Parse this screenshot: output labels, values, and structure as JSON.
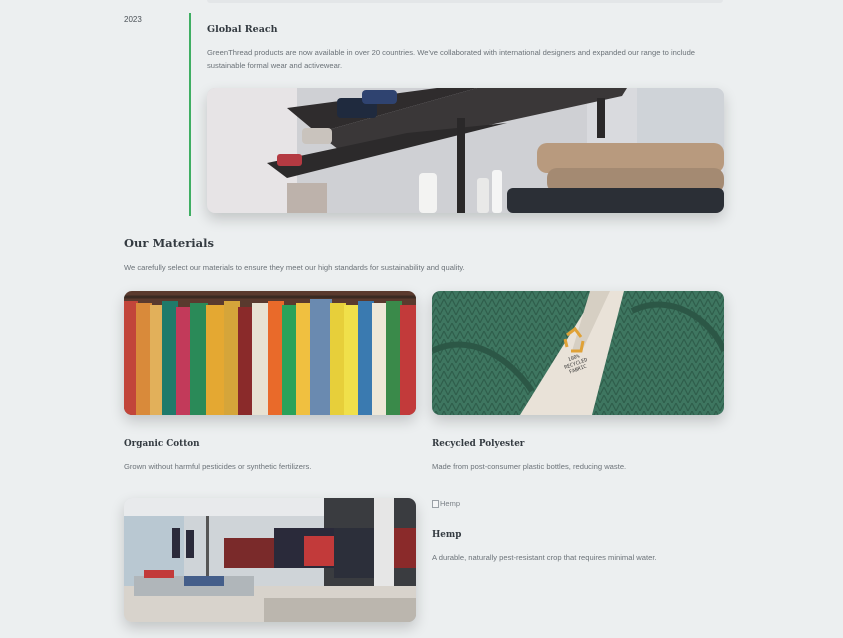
{
  "timeline": {
    "year": "2023",
    "title": "Global Reach",
    "description": "GreenThread products are now available in over 20 countries. We've collaborated with international designers and expanded our range to include sustainable formal wear and activewear."
  },
  "materials": {
    "heading": "Our Materials",
    "intro": "We carefully select our materials to ensure they meet our high standards for sustainability and quality.",
    "items": [
      {
        "title": "Organic Cotton",
        "description": "Grown without harmful pesticides or synthetic fertilizers."
      },
      {
        "title": "Recycled Polyester",
        "description": "Made from post-consumer plastic bottles, reducing waste."
      },
      {
        "title": "Hemp",
        "description": "A durable, naturally pest-resistant crop that requires minimal water.",
        "image_alt": "Hemp"
      }
    ],
    "tag_text": [
      "100%",
      "RECYCLED",
      "FABRIC"
    ]
  },
  "colors": {
    "accent": "#3fae63",
    "background": "#eceff0",
    "sweater": "#3e7660",
    "recycle": "#e0a237"
  }
}
